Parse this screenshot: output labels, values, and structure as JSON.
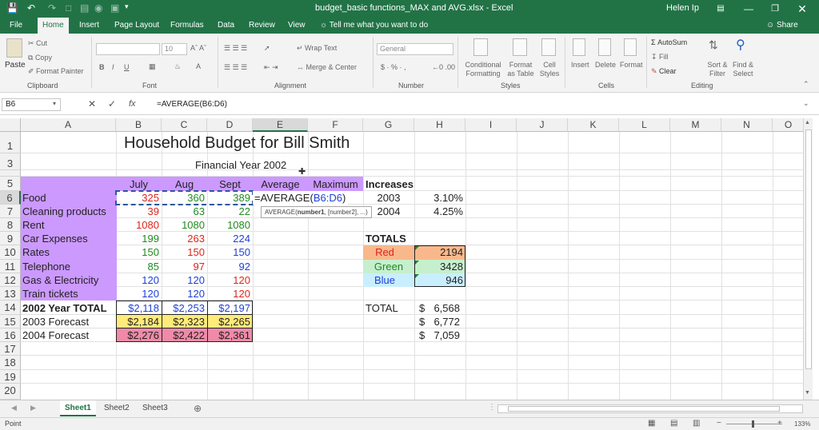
{
  "titlebar": {
    "doc_title": "budget_basic functions_MAX and AVG.xlsx - Excel",
    "user_name": "Helen Ip"
  },
  "tabs": [
    "File",
    "Home",
    "Insert",
    "Page Layout",
    "Formulas",
    "Data",
    "Review",
    "View"
  ],
  "tell_me": "Tell me what you want to do",
  "share_label": "Share",
  "ribbon": {
    "paste": "Paste",
    "cut": "Cut",
    "copy": "Copy",
    "format_painter": "Format Painter",
    "font_size": "10",
    "wrap_text": "Wrap Text",
    "merge_center": "Merge & Center",
    "number_format": "General",
    "conditional_formatting": "Conditional Formatting",
    "format_as_table": "Format as Table",
    "cell_styles": "Cell Styles",
    "insert": "Insert",
    "delete": "Delete",
    "format": "Format",
    "autosum": "AutoSum",
    "fill": "Fill",
    "clear": "Clear",
    "sort_filter": "Sort & Filter",
    "find_select": "Find & Select",
    "groups": [
      "Clipboard",
      "Font",
      "Alignment",
      "Number",
      "Styles",
      "Cells",
      "Editing"
    ]
  },
  "formula_bar": {
    "name_box": "B6",
    "formula": "=AVERAGE(B6:D6)",
    "fx": "fx"
  },
  "columns": [
    "A",
    "B",
    "C",
    "D",
    "E",
    "F",
    "G",
    "H",
    "I",
    "J",
    "K",
    "L",
    "M",
    "N",
    "O"
  ],
  "row_numbers": [
    "1",
    "3",
    "5",
    "6",
    "7",
    "8",
    "9",
    "10",
    "11",
    "12",
    "13",
    "14",
    "15",
    "16",
    "17",
    "18",
    "19",
    "20"
  ],
  "sheet": {
    "title": "Household Budget for Bill Smith",
    "subtitle": "Financial Year 2002",
    "headers": [
      "July",
      "Aug",
      "Sept",
      "Average",
      "Maximum"
    ],
    "increases_header": "Increases",
    "rows": [
      {
        "label": "Food",
        "v": [
          "325",
          "360",
          "389"
        ]
      },
      {
        "label": "Cleaning products",
        "v": [
          "39",
          "63",
          "22"
        ]
      },
      {
        "label": "Rent",
        "v": [
          "1080",
          "1080",
          "1080"
        ]
      },
      {
        "label": "Car Expenses",
        "v": [
          "199",
          "263",
          "224"
        ]
      },
      {
        "label": "Rates",
        "v": [
          "150",
          "150",
          "150"
        ]
      },
      {
        "label": "Telephone",
        "v": [
          "85",
          "97",
          "92"
        ]
      },
      {
        "label": "Gas & Electricity",
        "v": [
          "120",
          "120",
          "120"
        ]
      },
      {
        "label": "Train tickets",
        "v": [
          "120",
          "120",
          "120"
        ]
      }
    ],
    "total_2002": {
      "label": "2002 Year TOTAL",
      "v": [
        "$2,118",
        "$2,253",
        "$2,197"
      ]
    },
    "forecast_2003": {
      "label": "2003 Forecast",
      "v": [
        "$2,184",
        "$2,323",
        "$2,265"
      ]
    },
    "forecast_2004": {
      "label": "2004 Forecast",
      "v": [
        "$2,276",
        "$2,422",
        "$2,361"
      ]
    },
    "editing_formula_prefix": "=AVERAGE(",
    "editing_formula_ref": "B6:D6",
    "editing_formula_suffix": ")",
    "tooltip_fn": "AVERAGE(",
    "tooltip_arg1": "number1",
    "tooltip_rest": ", [number2], ...)",
    "increases": [
      {
        "year": "2003",
        "pct": "3.10%"
      },
      {
        "year": "2004",
        "pct": "4.25%"
      }
    ],
    "totals_header": "TOTALS",
    "totals": [
      {
        "label": "Red",
        "value": "2194"
      },
      {
        "label": "Green",
        "value": "3428"
      },
      {
        "label": "Blue",
        "value": "946"
      }
    ],
    "grand_total_label": "TOTAL",
    "grand_totals": [
      {
        "cur": "$",
        "value": "6,568"
      },
      {
        "cur": "$",
        "value": "6,772"
      },
      {
        "cur": "$",
        "value": "7,059"
      }
    ]
  },
  "sheet_tabs": [
    "Sheet1",
    "Sheet2",
    "Sheet3"
  ],
  "status": {
    "mode": "Point",
    "zoom": "133%"
  },
  "colors": {
    "excel_green": "#217346",
    "label_purple": "#cc99ff",
    "red_text": "#e0231b",
    "green_text": "#1f8a1f",
    "blue_text": "#1f3fd6",
    "forecast_yellow": "#ffeb7a",
    "forecast_pink": "#f08aa8",
    "total_red_fill": "#f8b88b",
    "total_green_fill": "#c6efce",
    "total_blue_fill": "#c9efff"
  }
}
